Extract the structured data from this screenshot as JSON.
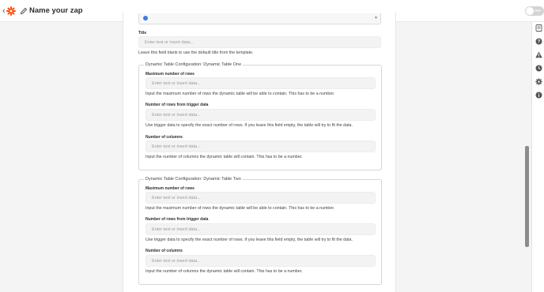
{
  "header": {
    "title": "Name your zap",
    "toggle_label": "OFF"
  },
  "title_field": {
    "label": "Title",
    "placeholder": "Enter text or insert data...",
    "help": "Leave this field blank to use the default title from the template."
  },
  "table_one": {
    "legend": "Dynamic Table Configuration: Dynamic Table One",
    "max_rows": {
      "label": "Maximum number of rows",
      "placeholder": "Enter text or insert data...",
      "help": "Input the maximum number of rows the dynamic table will be able to contain. This has to be a number."
    },
    "trigger_rows": {
      "label": "Number of rows from trigger data",
      "placeholder": "Enter text or insert data...",
      "help": "Use trigger data to specify the exact number of rows. If you leave this field empty, the table will try to fit the data."
    },
    "columns": {
      "label": "Number of columns",
      "placeholder": "Enter text or insert data...",
      "help": "Input the number of columns the dynamic table will contain. This has to be a number."
    }
  },
  "table_two": {
    "legend": "Dynamic Table Configuration: Dynamic Table Two",
    "max_rows": {
      "label": "Maximum number of rows",
      "placeholder": "Enter text or insert data...",
      "help": "Input the maximum number of rows the dynamic table will be able to contain. This has to be a number."
    },
    "trigger_rows": {
      "label": "Number of rows from trigger data",
      "placeholder": "Enter text or insert data...",
      "help": "Use trigger data to specify the exact number of rows. If you leave this field empty, the table will try to fit the data."
    },
    "columns": {
      "label": "Number of columns",
      "placeholder": "Enter text or insert data...",
      "help": "Input the number of columns the dynamic table will contain. This has to be a number."
    }
  },
  "rail": {
    "icons": [
      "outline-icon",
      "help-icon",
      "alert-icon",
      "history-icon",
      "settings-icon",
      "info-icon"
    ]
  },
  "colors": {
    "brand": "#ff4a00",
    "toggle_off": "#d4d4d4",
    "input_bg": "#f3f3f3"
  }
}
